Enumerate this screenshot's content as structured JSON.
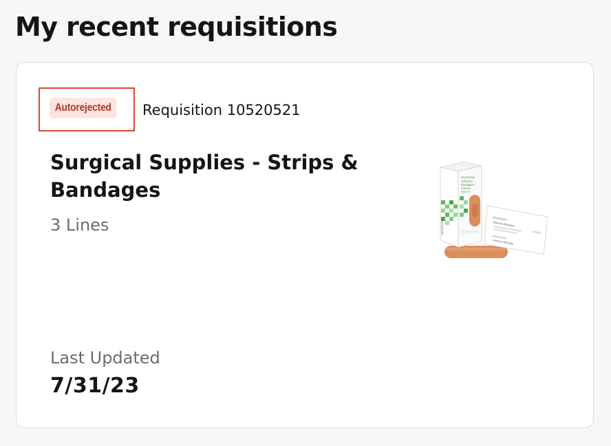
{
  "section": {
    "title": "My recent requisitions"
  },
  "requisition": {
    "status": "Autorejected",
    "number_label": "Requisition 10520521",
    "title": "Surgical Supplies - Strips & Bandages",
    "lines": "3 Lines",
    "updated_label": "Last Updated",
    "updated_value": "7/31/23"
  },
  "product_image": {
    "box_brand": "MCKESSON",
    "box_line1": "Adhesive",
    "box_line2": "Bandages",
    "box_line3": "FABRIC",
    "box_line4": "PATCH",
    "packet_brand": "MCKESSON",
    "packet_line": "Adhesive Bandage",
    "packet_line_bottom": "Adhesive Bandage"
  },
  "colors": {
    "status_text": "#b2372a",
    "status_background": "#fbe5e0",
    "highlight_border": "#d9462e",
    "card_border": "#dcdad7",
    "page_background": "#f8f7f6"
  }
}
